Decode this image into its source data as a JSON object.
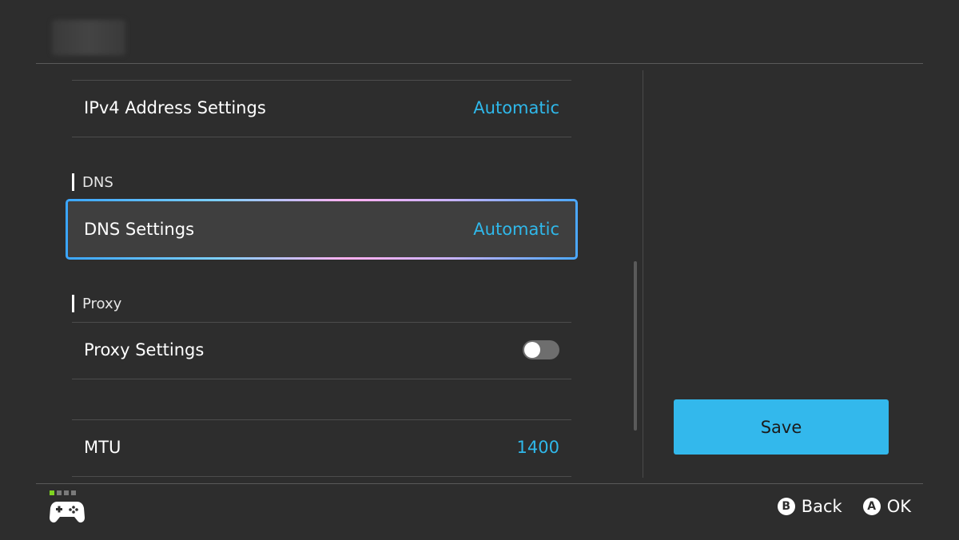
{
  "list": {
    "ipv4": {
      "label": "IPv4 Address Settings",
      "value": "Automatic"
    },
    "dns_section": "DNS",
    "dns": {
      "label": "DNS Settings",
      "value": "Automatic"
    },
    "proxy_section": "Proxy",
    "proxy": {
      "label": "Proxy Settings",
      "enabled": false
    },
    "mtu": {
      "label": "MTU",
      "value": "1400"
    }
  },
  "actions": {
    "save_label": "Save"
  },
  "footer": {
    "page_dots": {
      "total": 4,
      "active_index": 0
    },
    "back": {
      "glyph": "B",
      "label": "Back"
    },
    "ok": {
      "glyph": "A",
      "label": "OK"
    }
  },
  "colors": {
    "accent": "#2fb8ea",
    "save_button": "#33b8ec",
    "background": "#2d2d2d",
    "active_dot": "#7ed321"
  }
}
